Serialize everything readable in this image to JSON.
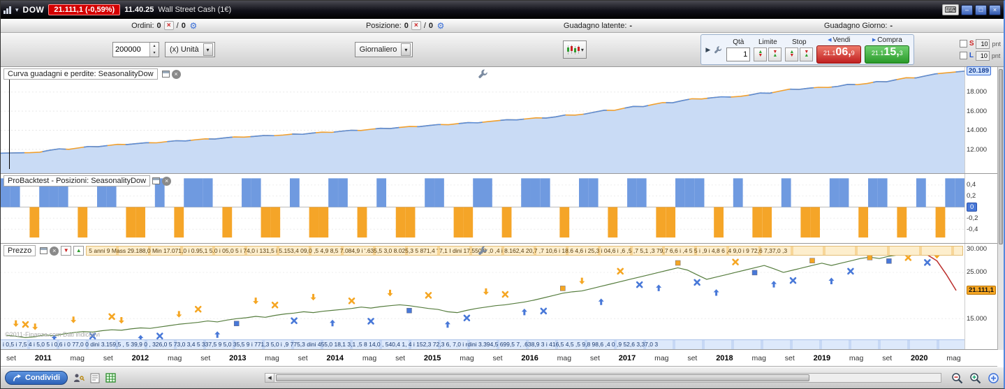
{
  "titlebar": {
    "symbol": "DOW",
    "price_badge": "21.111,1 (-0,59%)",
    "time": "11.40.25",
    "market": "Wall Street Cash (1€)",
    "minimize": "–",
    "maximize": "□",
    "close": "×",
    "keyboard": "⌨"
  },
  "infobar": {
    "orders_label": "Ordini:",
    "orders_open": "0",
    "orders_slash": "/",
    "orders_pending": "0",
    "position_label": "Posizione:",
    "position_open": "0",
    "position_slash": "/",
    "position_pending": "0",
    "latent_label": "Guadagno latente:",
    "latent_value": "-",
    "day_label": "Guadagno Giorno:",
    "day_value": "-"
  },
  "toolbar": {
    "quantity": "200000",
    "unit": "(x) Unità",
    "timeframe": "Giornaliero",
    "order_panel": {
      "qty_label": "Qtà",
      "qty_value": "1",
      "limit_label": "Limite",
      "stop_label": "Stop",
      "sell_label": "Vendi",
      "sell_price_full": "21.106,9",
      "sell_prefix": "21.1",
      "sell_big": "06,",
      "sell_sup": "9",
      "buy_label": "Compra",
      "buy_price_full": "21.115,3",
      "buy_prefix": "21.1",
      "buy_big": "15,",
      "buy_sup": "3",
      "s_label": "S",
      "s_value": "10",
      "s_unit": "pnt",
      "l_label": "L",
      "l_value": "10",
      "l_unit": "pnt"
    }
  },
  "colors": {
    "accent_blue": "#4878d8",
    "accent_orange": "#f5a623",
    "pos_bar_blue": "#6f9ae0",
    "pos_bar_orange": "#f5a528",
    "equity_fill": "#c9dbf5",
    "equity_line_blue": "#5b8dd9",
    "equity_line_orange": "#f0a030",
    "price_line_green": "#567d3e",
    "price_crash_red": "#c03030",
    "sell_red": "#cc2222",
    "buy_green": "#2f9e2f"
  },
  "chart_data": [
    {
      "type": "area",
      "title": "Curva guadagni e perdite: SeasonalityDow",
      "ylim": [
        9500,
        20620
      ],
      "yticks": [
        {
          "label": "18.000",
          "v": 18000
        },
        {
          "label": "16.000",
          "v": 16000
        },
        {
          "label": "14.000",
          "v": 14000
        },
        {
          "label": "12.000",
          "v": 12000
        }
      ],
      "current": {
        "label": "20.189",
        "v": 20189
      },
      "values": [
        11600,
        11620,
        11640,
        11650,
        11700,
        11900,
        12050,
        12000,
        12150,
        12300,
        12280,
        12400,
        12520,
        12500,
        12600,
        12700,
        12680,
        12800,
        12900,
        12880,
        13000,
        13100,
        13080,
        13200,
        13300,
        13280,
        13350,
        13450,
        13430,
        13500,
        13600,
        13580,
        13700,
        13800,
        13780,
        13900,
        14000,
        13980,
        14100,
        14200,
        14180,
        14300,
        14400,
        14380,
        14500,
        14600,
        14580,
        14700,
        14800,
        14780,
        14900,
        15000,
        15100,
        15080,
        15200,
        15300,
        15280,
        15400,
        15600,
        15580,
        15700,
        15900,
        16100,
        16080,
        16300,
        16500,
        16480,
        16700,
        16900,
        16880,
        17100,
        17300,
        17280,
        17400,
        17500,
        17480,
        17550,
        17700,
        17900,
        17880,
        18100,
        18300,
        18280,
        18400,
        18500,
        18480,
        18600,
        18800,
        18780,
        18900,
        19100,
        19080,
        19300,
        19500,
        19480,
        19700,
        19900,
        20000,
        20100,
        20189
      ]
    },
    {
      "type": "bar",
      "title": "ProBacktest - Posizioni: SeasonalityDow",
      "ylim": [
        -0.65,
        0.6
      ],
      "yticks": [
        {
          "label": "0,4",
          "v": 0.4
        },
        {
          "label": "0,2",
          "v": 0.2
        },
        {
          "label": "-0,2",
          "v": -0.2
        },
        {
          "label": "-0,4",
          "v": -0.4
        }
      ],
      "zero": {
        "label": "0",
        "v": 0
      },
      "values": [
        1,
        1,
        0,
        -1,
        1,
        1,
        1,
        0,
        -1,
        0,
        1,
        1,
        0,
        -1,
        -1,
        0,
        1,
        0,
        -1,
        1,
        1,
        1,
        0,
        -1,
        0,
        1,
        1,
        -1,
        -1,
        0,
        1,
        0,
        -1,
        -1,
        1,
        1,
        0,
        -1,
        0,
        1,
        0,
        -1,
        -1,
        0,
        1,
        1,
        0,
        -1,
        -1,
        1,
        1,
        0,
        -1,
        0,
        1,
        1,
        1,
        0,
        -1,
        0,
        1,
        1,
        0,
        -1,
        0,
        1,
        1,
        0,
        -1,
        -1,
        1,
        1,
        1,
        0,
        -1,
        0,
        1,
        0,
        -1,
        -1,
        0,
        1,
        0,
        -1,
        -1,
        0,
        1,
        1,
        0,
        -1,
        1,
        1,
        0,
        -1,
        0,
        1,
        0,
        -1,
        1,
        1
      ]
    },
    {
      "type": "line",
      "title": "Prezzo",
      "ylim": [
        8400,
        31200
      ],
      "yticks": [
        {
          "label": "30.000",
          "v": 30000
        },
        {
          "label": "25.000",
          "v": 25000
        },
        {
          "label": "15.000",
          "v": 15000
        }
      ],
      "current": {
        "label": "21.111,1",
        "v": 21111
      },
      "annotation_top": "5 anni 9 Mass 29.188,0 Min 17.071,0 i 0.95,1 5.0 i 05,0 5 i 74,0 i 131,5 i 5.153,4 09,0 ,5 4,9 8,5 7.084,9 i '.635,5 3,0 8.025,3 5 871,4 ' 7,1 I dini 17.550,8 ,0 ,4 i 8.162,4 20,7 ,7 10,6 i 18.6 4,6 i 25,3 i 04,6 i ,6 ,5 ,7 5,1 ,3 79,7 6,6 i ,4 5 5 i ,9 i 4,8 6 ,4 9,0 i 9 72,6 7,37,0 ,3",
      "annotation_bottom": "i 0,5 i 7,5 4 i 5,0 5 i 0,6 i 0 77,0 0 dini 3.159,5 , 5 39,9 0 , 326,0 5 73,0 3,4 5 337,5 9 5,0 35,5 9 i 771,3 5,0 i ,9 775,3 dini 455,0 18,1 3,1 ,5 8 14,0 , 540,4 1, 4 i 152,3 72,3 6, 7,0 i rdini 3.394,5 699,5 7, .638,9 3 i 416,5 4,5 ,5 9,8 98,6 ,4 0 ,9 52,6 3,37,0 3",
      "values": [
        11400,
        11200,
        10900,
        11100,
        11500,
        11300,
        11700,
        12000,
        12200,
        12100,
        12400,
        12600,
        12500,
        12800,
        13000,
        12900,
        13200,
        13500,
        13800,
        14000,
        14200,
        14500,
        14300,
        14700,
        15000,
        15200,
        15500,
        15300,
        15700,
        16000,
        16200,
        16500,
        16300,
        16600,
        16800,
        17000,
        17200,
        17500,
        17300,
        17600,
        17800,
        18000,
        17800,
        17500,
        17200,
        17000,
        16500,
        16300,
        16800,
        17200,
        17500,
        17800,
        18000,
        18300,
        18600,
        19000,
        19500,
        20000,
        20500,
        20800,
        21000,
        21500,
        22000,
        22500,
        23000,
        23500,
        24000,
        24500,
        25000,
        25500,
        26000,
        25500,
        24500,
        23500,
        24000,
        24500,
        25000,
        25500,
        26000,
        26500,
        25800,
        25000,
        25500,
        26000,
        26500,
        27000,
        26500,
        27000,
        27500,
        28000,
        28300,
        28000,
        28500,
        28800,
        29000,
        29188,
        28800,
        27500,
        24500,
        21111
      ],
      "markers": [
        {
          "i": 1,
          "t": "da"
        },
        {
          "i": 2,
          "t": "ox"
        },
        {
          "i": 3,
          "t": "da"
        },
        {
          "i": 5,
          "t": "ua"
        },
        {
          "i": 7,
          "t": "da"
        },
        {
          "i": 9,
          "t": "bx"
        },
        {
          "i": 11,
          "t": "ox"
        },
        {
          "i": 12,
          "t": "da"
        },
        {
          "i": 14,
          "t": "ua"
        },
        {
          "i": 16,
          "t": "bx"
        },
        {
          "i": 18,
          "t": "da"
        },
        {
          "i": 20,
          "t": "ox"
        },
        {
          "i": 22,
          "t": "ua"
        },
        {
          "i": 24,
          "t": "bq"
        },
        {
          "i": 26,
          "t": "da"
        },
        {
          "i": 28,
          "t": "ox"
        },
        {
          "i": 30,
          "t": "bx"
        },
        {
          "i": 32,
          "t": "da"
        },
        {
          "i": 34,
          "t": "ua"
        },
        {
          "i": 36,
          "t": "ox"
        },
        {
          "i": 38,
          "t": "bx"
        },
        {
          "i": 40,
          "t": "da"
        },
        {
          "i": 42,
          "t": "bq"
        },
        {
          "i": 44,
          "t": "ox"
        },
        {
          "i": 46,
          "t": "ua"
        },
        {
          "i": 48,
          "t": "bx"
        },
        {
          "i": 50,
          "t": "da"
        },
        {
          "i": 52,
          "t": "ox"
        },
        {
          "i": 54,
          "t": "ua"
        },
        {
          "i": 56,
          "t": "bx"
        },
        {
          "i": 58,
          "t": "oq"
        },
        {
          "i": 60,
          "t": "da"
        },
        {
          "i": 62,
          "t": "ua"
        },
        {
          "i": 64,
          "t": "ox"
        },
        {
          "i": 66,
          "t": "bx"
        },
        {
          "i": 68,
          "t": "ua"
        },
        {
          "i": 70,
          "t": "oq"
        },
        {
          "i": 72,
          "t": "bx"
        },
        {
          "i": 74,
          "t": "ua"
        },
        {
          "i": 76,
          "t": "ox"
        },
        {
          "i": 78,
          "t": "bq"
        },
        {
          "i": 80,
          "t": "ua"
        },
        {
          "i": 82,
          "t": "bx"
        },
        {
          "i": 84,
          "t": "oq"
        },
        {
          "i": 86,
          "t": "ua"
        },
        {
          "i": 88,
          "t": "bx"
        },
        {
          "i": 90,
          "t": "oq"
        },
        {
          "i": 92,
          "t": "bq"
        },
        {
          "i": 94,
          "t": "ox"
        },
        {
          "i": 96,
          "t": "bx"
        },
        {
          "i": 97,
          "t": "da"
        }
      ]
    }
  ],
  "xaxis": {
    "labels": [
      "set",
      "2011",
      "mag",
      "set",
      "2012",
      "mag",
      "set",
      "2013",
      "mag",
      "set",
      "2014",
      "mag",
      "set",
      "2015",
      "mag",
      "set",
      "2016",
      "mag",
      "set",
      "2017",
      "mag",
      "set",
      "2018",
      "mag",
      "set",
      "2019",
      "mag",
      "set",
      "2020",
      "mag"
    ]
  },
  "bottombar": {
    "share_label": "Condividi"
  },
  "watermark": "©2011-Finanza.com Dati indicativi"
}
